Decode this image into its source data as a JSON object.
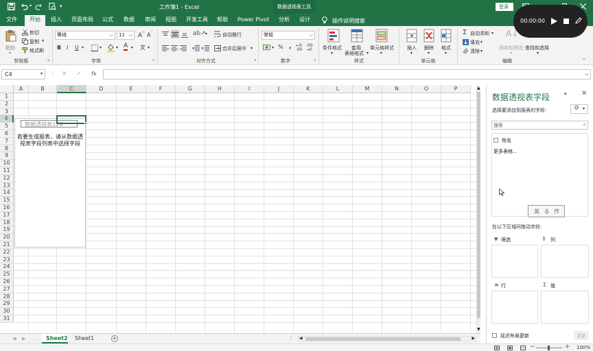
{
  "window": {
    "title": "工作簿1 - Excel",
    "context_tool": "数据透视表工具",
    "login_label": "登录",
    "recording_time": "00:00:00"
  },
  "tabs": [
    "文件",
    "开始",
    "插入",
    "页面布局",
    "公式",
    "数据",
    "审阅",
    "视图",
    "开发工具",
    "帮助",
    "Power Pivot",
    "分析",
    "设计"
  ],
  "tell_me": "操作说明搜索",
  "ribbon": {
    "clipboard": {
      "paste": "粘贴",
      "cut": "剪切",
      "copy": "复制",
      "format_painter": "格式刷",
      "group": "剪贴板"
    },
    "font": {
      "name": "等线",
      "size": "11",
      "bold": "B",
      "italic": "I",
      "underline": "U",
      "group": "字体"
    },
    "alignment": {
      "wrap": "自动换行",
      "merge": "合并后居中",
      "group": "对齐方式"
    },
    "number": {
      "format": "常规",
      "percent": "%",
      "comma": ",",
      "group": "数字"
    },
    "styles": {
      "conditional": "条件格式",
      "table_line1": "套用",
      "table_line2": "表格格式",
      "cell_styles": "单元格样式",
      "group": "样式"
    },
    "cells": {
      "insert": "插入",
      "delete": "删除",
      "format": "格式",
      "group": "单元格"
    },
    "editing": {
      "autosum": "自动求和",
      "fill": "填充",
      "clear": "清除",
      "sort": "排序和筛选",
      "find": "查找和选择",
      "group": "编辑"
    }
  },
  "formula_bar": {
    "name_box": "C4",
    "formula": "",
    "fx": "fx"
  },
  "grid": {
    "columns": [
      "A",
      "B",
      "C",
      "D",
      "E",
      "F",
      "G",
      "H",
      "I",
      "J",
      "K",
      "L",
      "M",
      "N",
      "O",
      "P"
    ],
    "rows": [
      "1",
      "2",
      "3",
      "4",
      "5",
      "6",
      "7",
      "8",
      "9",
      "10",
      "11",
      "12",
      "13",
      "14",
      "15",
      "16",
      "17",
      "18",
      "19",
      "20",
      "21",
      "22",
      "23",
      "24",
      "25",
      "26",
      "27",
      "28",
      "29",
      "30",
      "31"
    ],
    "pivot_name": "数据透视表229",
    "pivot_hint": "若要生成报表，请从数据透视表字段列表中选择字段"
  },
  "sheets": {
    "tabs": [
      "Sheet2",
      "Sheet1"
    ],
    "active": "Sheet2"
  },
  "status": {
    "zoom": "100%"
  },
  "pane": {
    "title": "数据透视表字段",
    "subtitle": "选择要添加到报表的字段:",
    "search_placeholder": "搜索",
    "fields": [
      "姓名"
    ],
    "more_tables": "更多表格...",
    "stamp_text": "英 る 作",
    "drag_hint": "在以下区域间拖动字段:",
    "areas": {
      "filter": "筛选",
      "columns": "列",
      "rows": "行",
      "values": "值"
    },
    "defer_label": "延迟布局更新",
    "update_label": "更新"
  }
}
